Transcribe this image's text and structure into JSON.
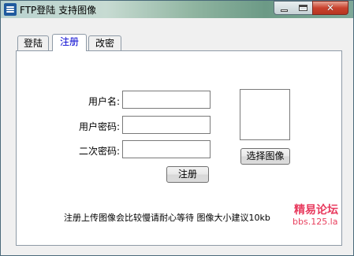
{
  "window": {
    "title": "FTP登陆 支持图像",
    "close_glyph": "✕"
  },
  "tabs": [
    {
      "label": "登陆",
      "selected": false
    },
    {
      "label": "注册",
      "selected": true
    },
    {
      "label": "改密",
      "selected": false
    }
  ],
  "form": {
    "username_label": "用户名:",
    "password_label": "用户密码:",
    "confirm_label": "二次密码:",
    "username_value": "",
    "password_value": "",
    "confirm_value": "",
    "choose_image_label": "选择图像",
    "register_label": "注册",
    "note": "注册上传图像会比较慢请耐心等待 图像大小建议10kb"
  },
  "watermark": {
    "line1": "精易论坛",
    "line2": "bbs.125.la"
  },
  "colors": {
    "selected_tab_text": "#0000d0",
    "watermark": "#e83a5e"
  }
}
